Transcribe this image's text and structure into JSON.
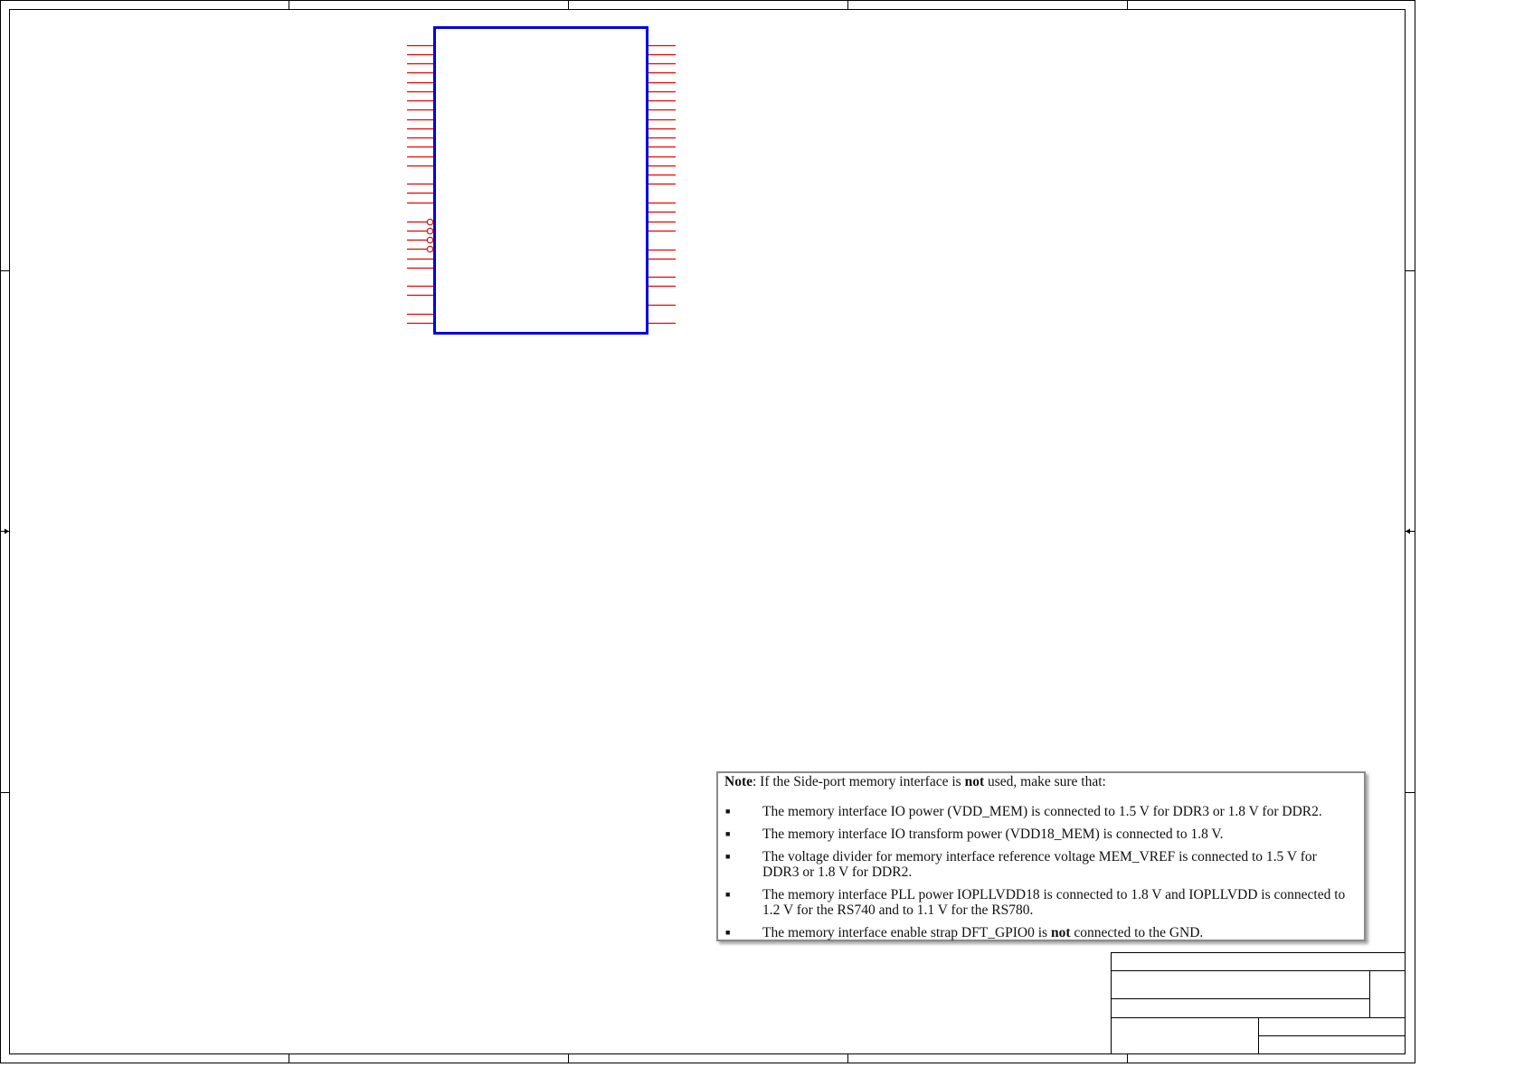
{
  "colors": {
    "frame": "#000000",
    "ic_body": "#0000e0",
    "pins": "#ee0000",
    "note_border": "#8a8a8a"
  },
  "note": {
    "label": "Note",
    "intro_a": ": If the Side-port memory interface is ",
    "intro_not": "not",
    "intro_b": " used, make sure that:",
    "items": [
      {
        "a": "The memory interface IO power (VDD_MEM) is connected to 1.5 V for DDR3 or 1.8 V for DDR2."
      },
      {
        "a": "The memory interface IO transform power (VDD18_MEM) is connected to 1.8 V."
      },
      {
        "a": "The voltage divider for memory interface reference voltage MEM_VREF is connected to 1.5 V for DDR3 or 1.8 V for DDR2."
      },
      {
        "a": "The memory interface PLL power IOPLLVDD18 is connected to 1.8 V and IOPLLVDD is connected to 1.2 V for the RS740 and to 1.1 V for the RS780."
      },
      {
        "a": "The memory interface enable strap DFT_GPIO0 is ",
        "not": "not",
        "b": " connected to the GND."
      }
    ]
  }
}
